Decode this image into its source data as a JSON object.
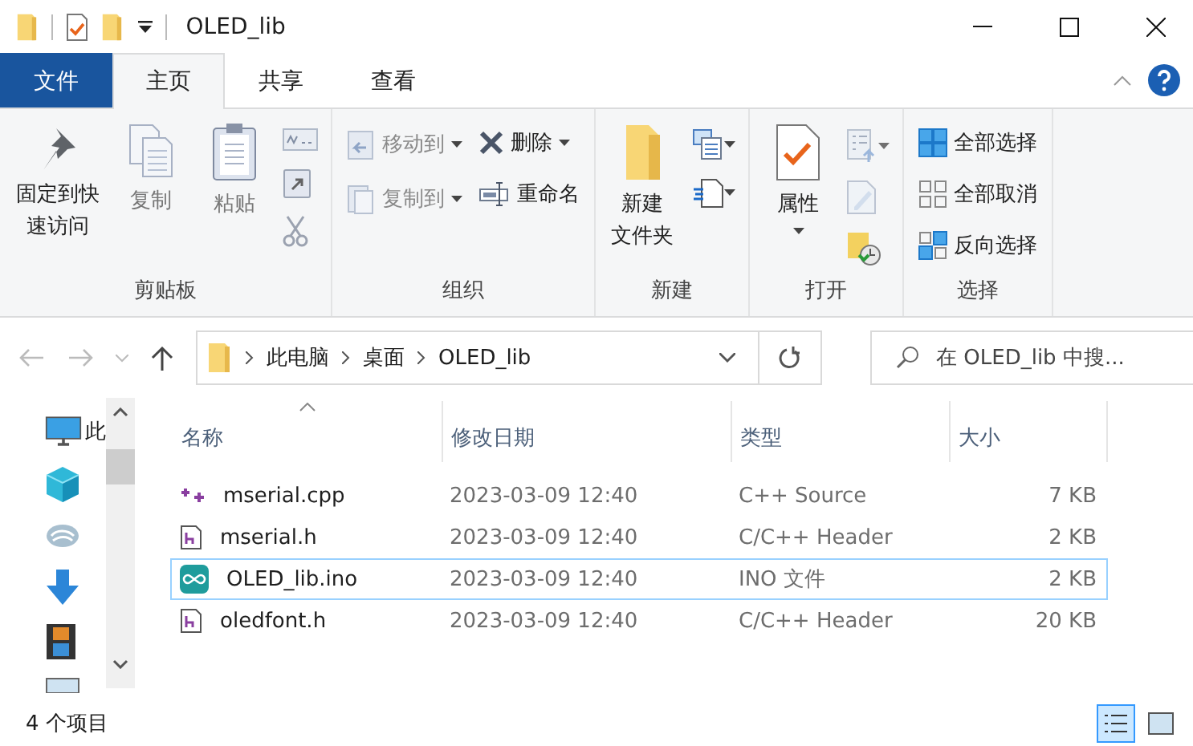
{
  "window": {
    "title": "OLED_lib"
  },
  "tabs": [
    {
      "label": "文件",
      "kind": "file",
      "selected": false
    },
    {
      "label": "主页",
      "kind": "tab",
      "selected": true
    },
    {
      "label": "共享",
      "kind": "tab",
      "selected": false
    },
    {
      "label": "查看",
      "kind": "tab",
      "selected": false
    }
  ],
  "ribbon": [
    {
      "label": "剪贴板",
      "items": [
        {
          "kind": "large",
          "label": "固定到快速访问",
          "disabled": false
        },
        {
          "kind": "large",
          "label": "复制",
          "disabled": true
        },
        {
          "kind": "large",
          "label": "粘贴",
          "disabled": true
        },
        {
          "kind": "icon",
          "disabled": true
        },
        {
          "kind": "icon",
          "disabled": true
        },
        {
          "kind": "icon",
          "disabled": true
        }
      ]
    },
    {
      "label": "组织",
      "items": [
        {
          "kind": "small",
          "label": "移动到",
          "dropdown": true,
          "disabled": true
        },
        {
          "kind": "small",
          "label": "复制到",
          "dropdown": true,
          "disabled": true
        },
        {
          "kind": "small",
          "label": "删除",
          "dropdown": true,
          "disabled": false
        },
        {
          "kind": "small",
          "label": "重命名",
          "dropdown": false,
          "disabled": false
        }
      ]
    },
    {
      "label": "新建",
      "items": [
        {
          "kind": "large",
          "label": "新建文件夹",
          "disabled": false
        },
        {
          "kind": "icon",
          "dropdown": true,
          "disabled": false
        },
        {
          "kind": "icon",
          "dropdown": true,
          "disabled": false
        }
      ]
    },
    {
      "label": "打开",
      "items": [
        {
          "kind": "large",
          "label": "属性",
          "dropdown": true,
          "disabled": false
        },
        {
          "kind": "icon",
          "dropdown": true,
          "disabled": true
        },
        {
          "kind": "icon",
          "disabled": true
        },
        {
          "kind": "icon",
          "disabled": false
        }
      ]
    },
    {
      "label": "选择",
      "items": [
        {
          "kind": "small",
          "label": "全部选择",
          "disabled": false
        },
        {
          "kind": "small",
          "label": "全部取消",
          "disabled": false
        },
        {
          "kind": "small",
          "label": "反向选择",
          "disabled": false
        }
      ]
    }
  ],
  "address": {
    "path": [
      "此电脑",
      "桌面",
      "OLED_lib"
    ]
  },
  "search": {
    "placeholder": "在 OLED_lib 中搜..."
  },
  "nav": {
    "label": "此"
  },
  "table": {
    "columns": [
      {
        "label": "名称",
        "sorted": true
      },
      {
        "label": "修改日期",
        "sorted": false
      },
      {
        "label": "类型",
        "sorted": false
      },
      {
        "label": "大小",
        "sorted": false
      }
    ],
    "rows": [
      {
        "name": "mserial.cpp",
        "kind": "cpp",
        "date": "2023-03-09 12:40",
        "type": "C++ Source",
        "size": "7 KB",
        "selected": false
      },
      {
        "name": "mserial.h",
        "kind": "h",
        "date": "2023-03-09 12:40",
        "type": "C/C++ Header",
        "size": "2 KB",
        "selected": false
      },
      {
        "name": "OLED_lib.ino",
        "kind": "ino",
        "date": "2023-03-09 12:40",
        "type": "INO 文件",
        "size": "2 KB",
        "selected": true
      },
      {
        "name": "oledfont.h",
        "kind": "h",
        "date": "2023-03-09 12:40",
        "type": "C/C++ Header",
        "size": "20 KB",
        "selected": false
      }
    ]
  },
  "status_bar": {
    "count": "4 个项目",
    "views": [
      {
        "kind": "details",
        "selected": true
      },
      {
        "kind": "tiles",
        "selected": false
      }
    ]
  }
}
